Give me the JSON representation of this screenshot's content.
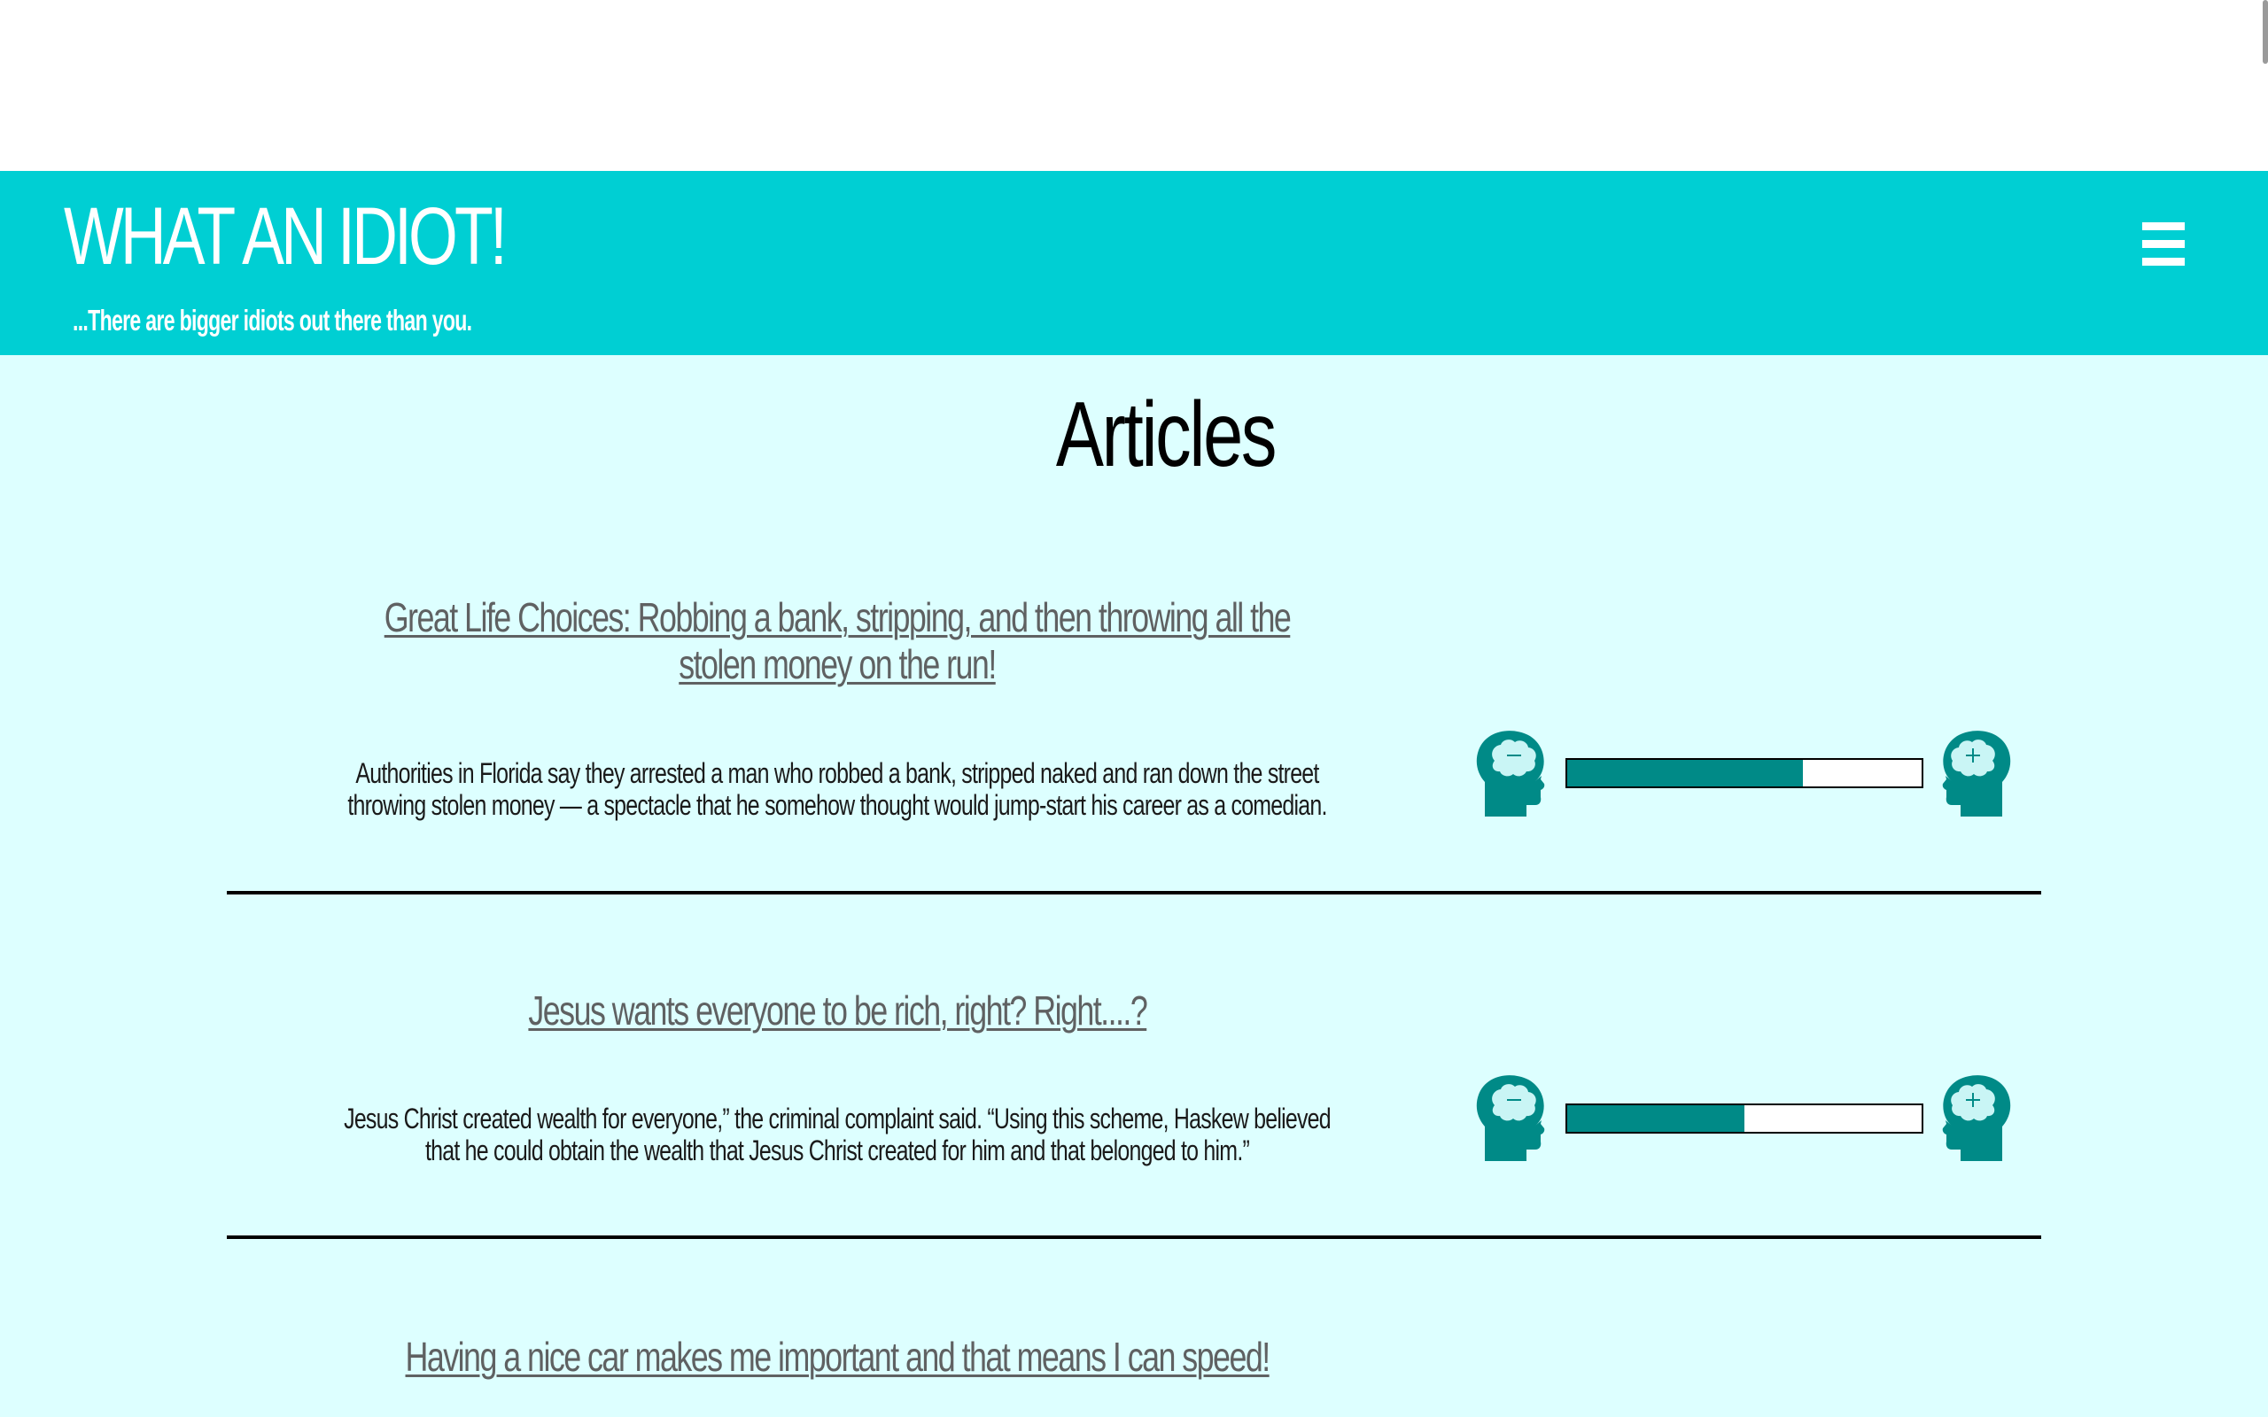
{
  "header": {
    "site_title": "WHAT AN IDIOT!",
    "tagline": "...There are bigger idiots out there than you.",
    "menu_icon": "hamburger-menu-icon",
    "background_color": "#00cfd3"
  },
  "main": {
    "page_title": "Articles",
    "background_color": "#ddffff",
    "meter_color": "#008a87",
    "articles": [
      {
        "title": "Great Life Choices: Robbing a bank, stripping, and then throwing all the stolen money on the run!",
        "summary": "Authorities in Florida say they arrested a man who robbed a bank, stripped naked and ran down the street throwing stolen money — a spectacle that he somehow thought would jump-start his career as a comedian.",
        "idiot_meter": 0.665,
        "minus_icon": "brain-head-minus-icon",
        "plus_icon": "brain-head-plus-icon"
      },
      {
        "title": "Jesus wants everyone to be rich, right? Right....?",
        "summary": "Jesus Christ created wealth for everyone,” the criminal complaint said. “Using this scheme, Haskew believed that he could obtain the wealth that Jesus Christ created for him and that belonged to him.”",
        "idiot_meter": 0.5,
        "minus_icon": "brain-head-minus-icon",
        "plus_icon": "brain-head-plus-icon"
      },
      {
        "title": "Having a nice car makes me important and that means I can speed!"
      }
    ]
  }
}
